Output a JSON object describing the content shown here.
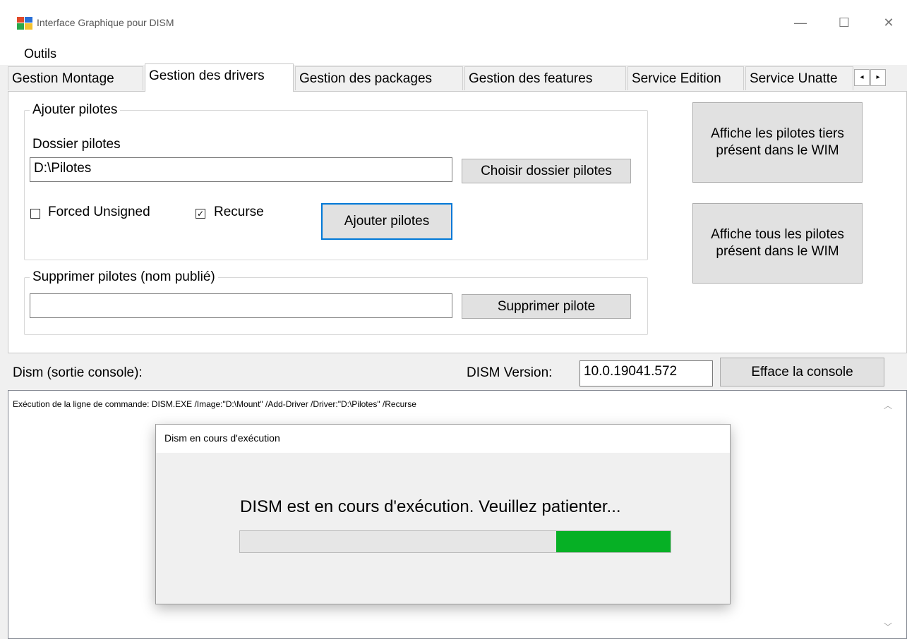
{
  "window": {
    "title": "Interface Graphique pour DISM",
    "icon": "app-window-icon",
    "minimize": "—",
    "maximize": "☐",
    "close": "✕"
  },
  "menu": {
    "items": [
      "Outils"
    ]
  },
  "tabs": [
    "Gestion Montage",
    "Gestion des drivers",
    "Gestion des packages",
    "Gestion des features",
    "Service Edition",
    "Service Unatte"
  ],
  "tab_scroll": {
    "left": "◂",
    "right": "▸"
  },
  "active_tab_index": 1,
  "add_drivers": {
    "group_label": "Ajouter pilotes",
    "folder_label": "Dossier pilotes",
    "folder_value": "D:\\Pilotes",
    "choose_button": "Choisir dossier pilotes",
    "forced_unsigned_label": "Forced Unsigned",
    "forced_unsigned_checked": false,
    "recurse_label": "Recurse",
    "recurse_checked": true,
    "add_button": "Ajouter pilotes"
  },
  "remove_drivers": {
    "group_label": "Supprimer pilotes (nom publié)",
    "input_value": "",
    "remove_button": "Supprimer pilote"
  },
  "side_buttons": {
    "third_party": "Affiche les pilotes tiers présent dans le WIM",
    "all": "Affiche tous les pilotes présent dans le WIM"
  },
  "console": {
    "label": "Dism (sortie console):",
    "version_label": "DISM Version:",
    "version_value": "10.0.19041.572",
    "clear_button": "Efface la console",
    "output": "Exécution de la ligne de commande: DISM.EXE /Image:\"D:\\Mount\" /Add-Driver /Driver:\"D:\\Pilotes\" /Recurse"
  },
  "dialog": {
    "title": "Dism en cours d'exécution",
    "message": "DISM est en cours d'exécution. Veuillez patienter...",
    "progress": {
      "fill_start": 0.735,
      "fill_end": 1.0,
      "color": "#06b025"
    }
  }
}
